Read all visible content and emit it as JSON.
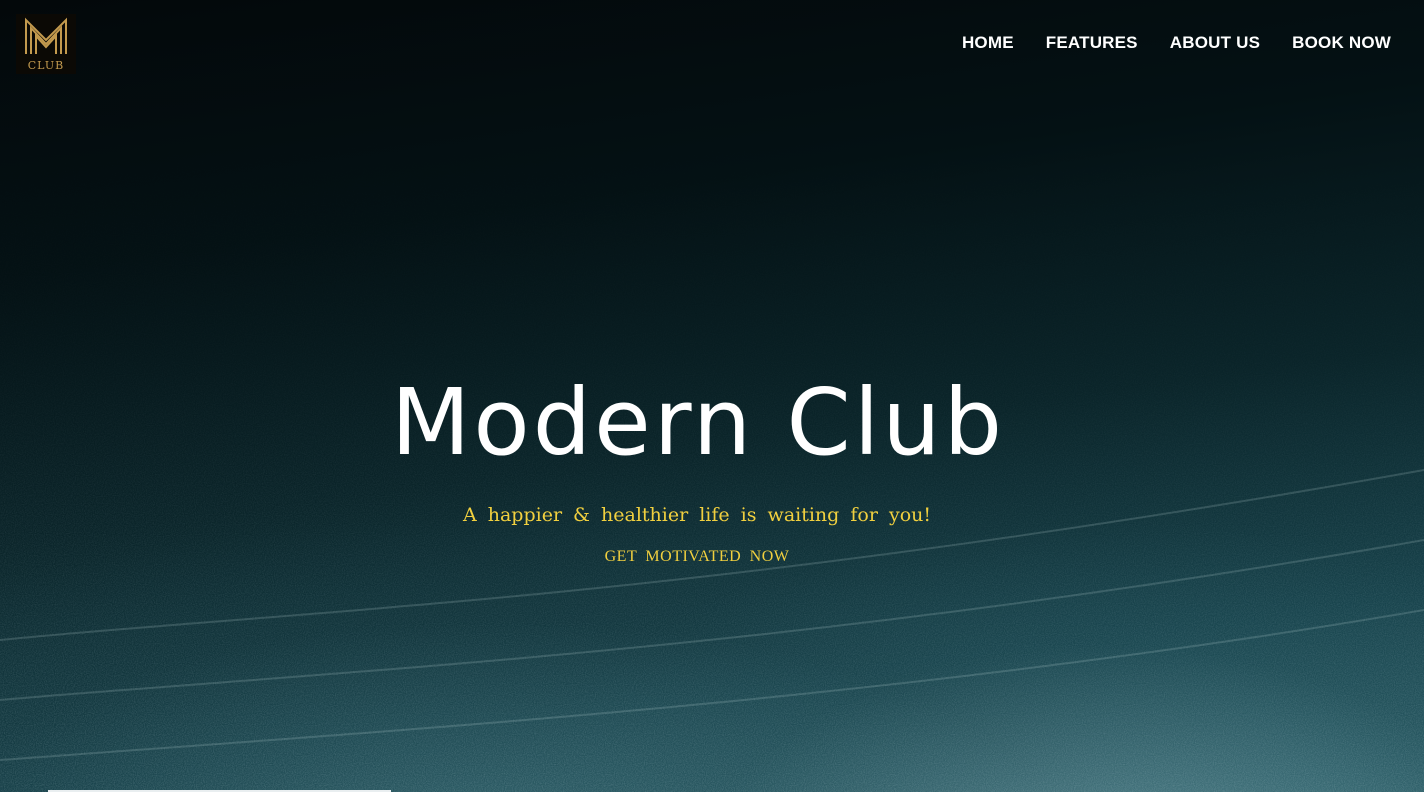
{
  "brand": {
    "logo_text": "CLUB",
    "logo_color": "#c39a4e"
  },
  "nav": {
    "items": [
      {
        "label": "HOME"
      },
      {
        "label": "FEATURES"
      },
      {
        "label": "ABOUT US"
      },
      {
        "label": "BOOK NOW"
      }
    ]
  },
  "hero": {
    "title": "Modern Club",
    "tagline": "A happier & healthier life is waiting for you!",
    "cta_label": "GET MOTIVATED NOW",
    "accent_color": "#f1d03f"
  }
}
